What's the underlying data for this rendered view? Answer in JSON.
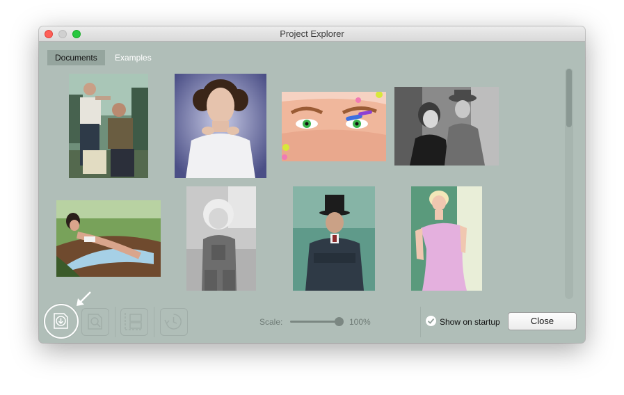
{
  "window": {
    "title": "Project Explorer"
  },
  "tabs": [
    {
      "label": "Documents",
      "active": true
    },
    {
      "label": "Examples",
      "active": false
    }
  ],
  "thumbnails": [
    {
      "name": "thumb-men-barber-outdoors"
    },
    {
      "name": "thumb-woman-hair-buns"
    },
    {
      "name": "thumb-eyes-painted-nails"
    },
    {
      "name": "thumb-couple-black-white"
    },
    {
      "name": "thumb-woman-in-boat"
    },
    {
      "name": "thumb-child-overalls"
    },
    {
      "name": "thumb-man-top-hat"
    },
    {
      "name": "thumb-woman-pink-dress"
    }
  ],
  "toolbar": {
    "import_icon": "import-icon",
    "search_icon": "magnify-icon",
    "split_icon": "split-view-icon",
    "history_icon": "history-icon"
  },
  "scale": {
    "label": "Scale:",
    "value_text": "100%",
    "value": 100
  },
  "startup": {
    "label": "Show on startup",
    "checked": true
  },
  "close_label": "Close",
  "colors": {
    "window_bg": "#b0beb8",
    "active_tab_bg": "#95a59e"
  }
}
